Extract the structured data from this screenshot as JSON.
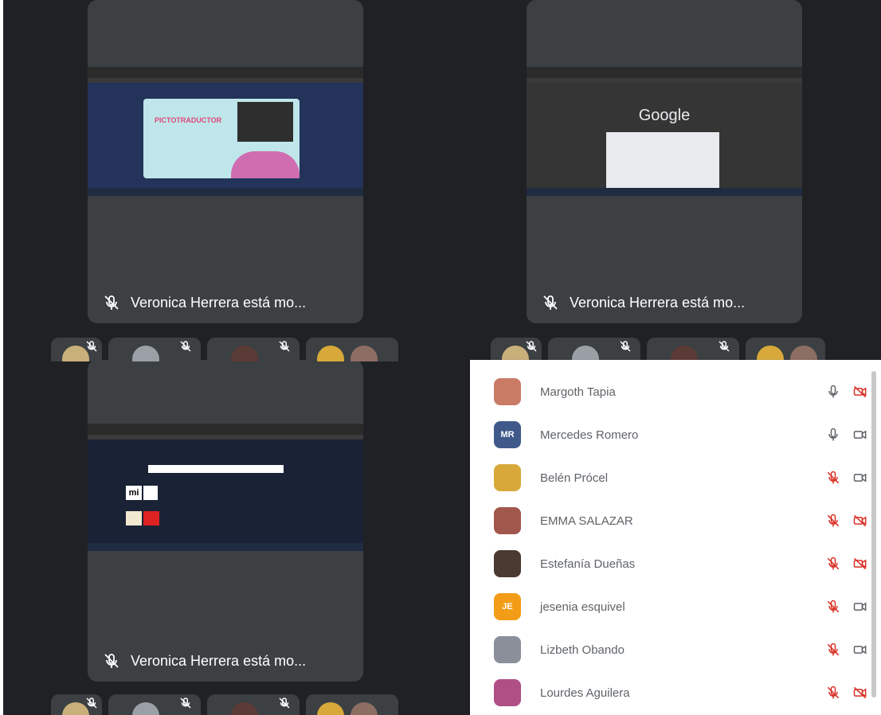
{
  "tiles": [
    {
      "caption": "Veronica Herrera está mo...",
      "screen": {
        "app_title": "PICTOTRADUCTOR"
      }
    },
    {
      "caption": "Veronica Herrera está mo...",
      "screen": {
        "app_title": "Google"
      }
    },
    {
      "caption": "Veronica Herrera está mo...",
      "screen": {
        "app_title": "mi"
      }
    }
  ],
  "participants": [
    {
      "name": "Margoth Tapia",
      "initials": "",
      "color": "#c97b66",
      "mic": "on",
      "camera": "off"
    },
    {
      "name": "Mercedes Romero",
      "initials": "MR",
      "color": "#3f5a8a",
      "mic": "on",
      "camera": "on"
    },
    {
      "name": "Belén Prócel",
      "initials": "",
      "color": "#d8a93a",
      "mic": "off",
      "camera": "on"
    },
    {
      "name": "EMMA SALAZAR",
      "initials": "",
      "color": "#a2574c",
      "mic": "off",
      "camera": "off"
    },
    {
      "name": "Estefanía Dueñas",
      "initials": "",
      "color": "#4a3a32",
      "mic": "off",
      "camera": "off"
    },
    {
      "name": "jesenia esquivel",
      "initials": "JE",
      "color": "#f29c17",
      "mic": "off",
      "camera": "on"
    },
    {
      "name": "Lizbeth Obando",
      "initials": "",
      "color": "#8a8f9a",
      "mic": "off",
      "camera": "on"
    },
    {
      "name": "Lourdes Aguilera",
      "initials": "",
      "color": "#b04f86",
      "mic": "off",
      "camera": "off"
    }
  ],
  "colors": {
    "background": "#202124",
    "tile": "#3c4043",
    "muted_red": "#d93025",
    "icon_gray": "#5f6368"
  }
}
